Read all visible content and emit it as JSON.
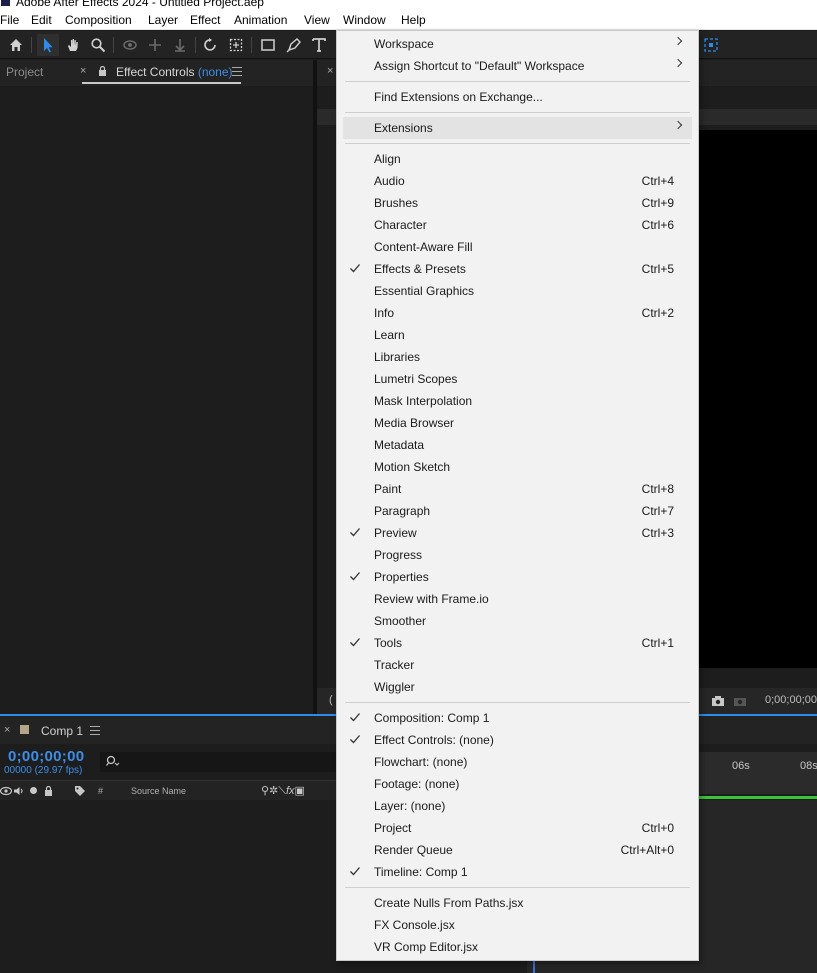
{
  "window": {
    "title": "Adobe After Effects 2024 - Untitled Project.aep"
  },
  "menubar": {
    "items": [
      "File",
      "Edit",
      "Composition",
      "Layer",
      "Effect",
      "Animation",
      "View",
      "Window",
      "Help"
    ]
  },
  "panels": {
    "project_tab": "Project",
    "effect_controls_tab": "Effect Controls",
    "effect_controls_target": "(none)"
  },
  "viewer": {
    "timecode": "0;00;00;00"
  },
  "timeline": {
    "comp_tab": "Comp 1",
    "current_time": "0;00;00;00",
    "frame_info": "00000 (29.97 fps)",
    "col_hash": "#",
    "col_source_name": "Source Name",
    "ruler_labels": [
      "06s",
      "08s"
    ]
  },
  "window_menu": {
    "workspace": "Workspace",
    "assign_shortcut": "Assign Shortcut to \"Default\" Workspace",
    "find_extensions": "Find Extensions on Exchange...",
    "extensions": "Extensions",
    "panels": [
      {
        "label": "Align",
        "shortcut": "",
        "checked": false
      },
      {
        "label": "Audio",
        "shortcut": "Ctrl+4",
        "checked": false
      },
      {
        "label": "Brushes",
        "shortcut": "Ctrl+9",
        "checked": false
      },
      {
        "label": "Character",
        "shortcut": "Ctrl+6",
        "checked": false
      },
      {
        "label": "Content-Aware Fill",
        "shortcut": "",
        "checked": false
      },
      {
        "label": "Effects & Presets",
        "shortcut": "Ctrl+5",
        "checked": true
      },
      {
        "label": "Essential Graphics",
        "shortcut": "",
        "checked": false
      },
      {
        "label": "Info",
        "shortcut": "Ctrl+2",
        "checked": false
      },
      {
        "label": "Learn",
        "shortcut": "",
        "checked": false
      },
      {
        "label": "Libraries",
        "shortcut": "",
        "checked": false
      },
      {
        "label": "Lumetri Scopes",
        "shortcut": "",
        "checked": false
      },
      {
        "label": "Mask Interpolation",
        "shortcut": "",
        "checked": false
      },
      {
        "label": "Media Browser",
        "shortcut": "",
        "checked": false
      },
      {
        "label": "Metadata",
        "shortcut": "",
        "checked": false
      },
      {
        "label": "Motion Sketch",
        "shortcut": "",
        "checked": false
      },
      {
        "label": "Paint",
        "shortcut": "Ctrl+8",
        "checked": false
      },
      {
        "label": "Paragraph",
        "shortcut": "Ctrl+7",
        "checked": false
      },
      {
        "label": "Preview",
        "shortcut": "Ctrl+3",
        "checked": true
      },
      {
        "label": "Progress",
        "shortcut": "",
        "checked": false
      },
      {
        "label": "Properties",
        "shortcut": "",
        "checked": true
      },
      {
        "label": "Review with Frame.io",
        "shortcut": "",
        "checked": false
      },
      {
        "label": "Smoother",
        "shortcut": "",
        "checked": false
      },
      {
        "label": "Tools",
        "shortcut": "Ctrl+1",
        "checked": true
      },
      {
        "label": "Tracker",
        "shortcut": "",
        "checked": false
      },
      {
        "label": "Wiggler",
        "shortcut": "",
        "checked": false
      }
    ],
    "viewers": [
      {
        "label": "Composition: Comp 1",
        "shortcut": "",
        "checked": true
      },
      {
        "label": "Effect Controls: (none)",
        "shortcut": "",
        "checked": true
      },
      {
        "label": "Flowchart: (none)",
        "shortcut": "",
        "checked": false
      },
      {
        "label": "Footage: (none)",
        "shortcut": "",
        "checked": false
      },
      {
        "label": "Layer: (none)",
        "shortcut": "",
        "checked": false
      },
      {
        "label": "Project",
        "shortcut": "Ctrl+0",
        "checked": false
      },
      {
        "label": "Render Queue",
        "shortcut": "Ctrl+Alt+0",
        "checked": false
      },
      {
        "label": "Timeline: Comp 1",
        "shortcut": "",
        "checked": true
      }
    ],
    "scripts": [
      {
        "label": "Create Nulls From Paths.jsx"
      },
      {
        "label": "FX Console.jsx"
      },
      {
        "label": "VR Comp Editor.jsx"
      }
    ]
  }
}
